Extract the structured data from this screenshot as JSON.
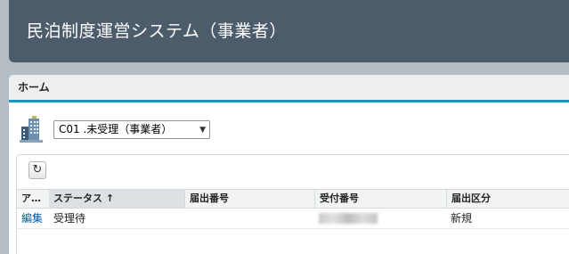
{
  "app": {
    "title": "民泊制度運営システム（事業者）"
  },
  "tab": {
    "label": "ホーム"
  },
  "view": {
    "selected": "C01 .未受理（事業者）"
  },
  "list": {
    "columns": [
      "ア…",
      "ステータス ↑",
      "届出番号",
      "受付番号",
      "届出区分"
    ],
    "rows": [
      {
        "action": "編集",
        "status": "受理待",
        "notification_no": "",
        "reception_no": "",
        "category": "新規"
      }
    ]
  },
  "colors": {
    "header": "#4d5c6b",
    "accent": "#1797c0",
    "link": "#015ba7"
  }
}
